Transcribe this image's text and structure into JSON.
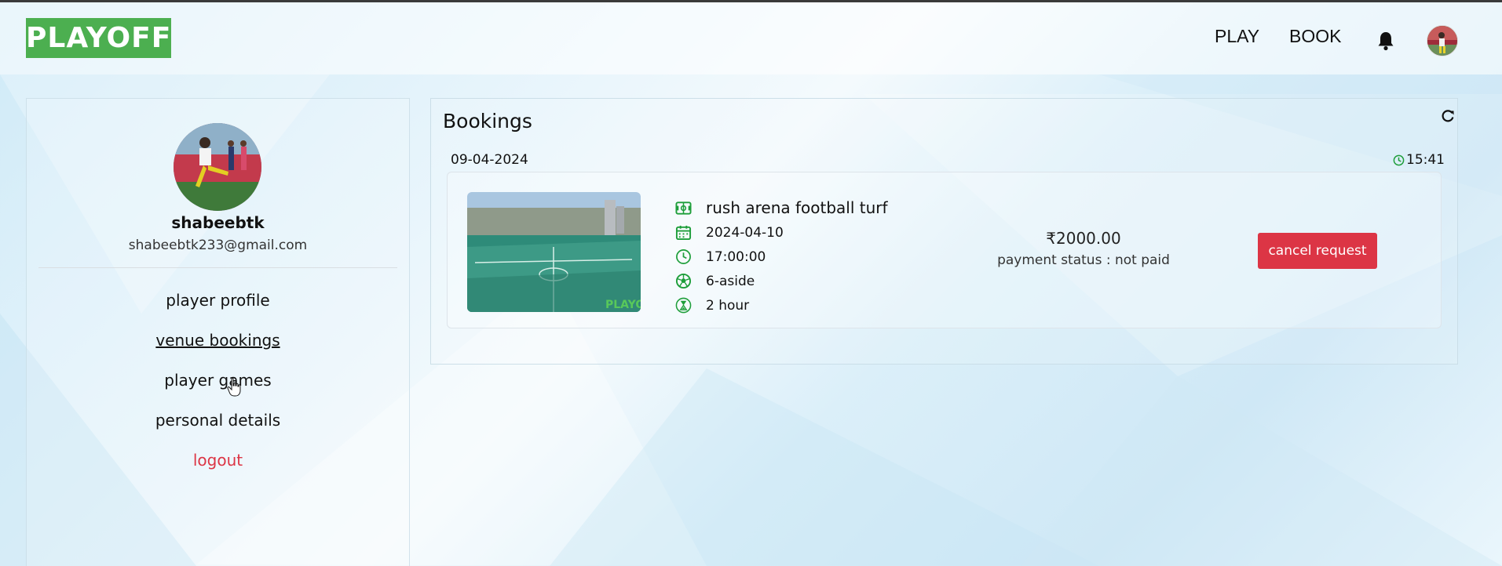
{
  "header": {
    "logo_text": "PLAYOFF",
    "nav": {
      "play": "PLAY",
      "book": "BOOK"
    }
  },
  "profile": {
    "username": "shabeebtk",
    "email": "shabeebtk233@gmail.com"
  },
  "sidebar": {
    "items": [
      {
        "label": "player profile"
      },
      {
        "label": "venue bookings"
      },
      {
        "label": "player games"
      },
      {
        "label": "personal details"
      },
      {
        "label": "logout"
      }
    ]
  },
  "bookings": {
    "title": "Bookings",
    "date": "09-04-2024",
    "time": "15:41",
    "card": {
      "venue": "rush arena football turf",
      "booking_date": "2024-04-10",
      "slot_time": "17:00:00",
      "format": "6-aside",
      "duration": "2 hour",
      "price": "₹2000.00",
      "payment_status": "payment status : not paid",
      "cancel_label": "cancel request",
      "thumb_watermark": "PLAYO"
    }
  },
  "colors": {
    "brand_green": "#4caf50",
    "icon_green": "#1e9e3a",
    "danger": "#dc3545"
  }
}
